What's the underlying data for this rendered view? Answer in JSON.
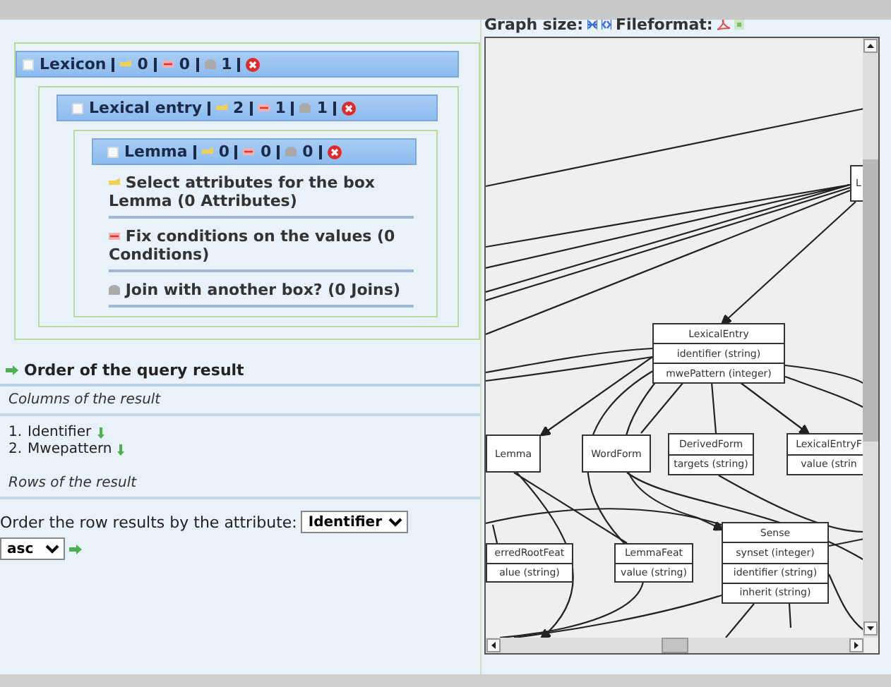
{
  "query_box": {
    "title": "Lexicon",
    "attributes": "0",
    "conditions": "0",
    "joins": "1",
    "children": [
      {
        "title": "Lexical entry",
        "attributes": "2",
        "conditions": "1",
        "joins": "1",
        "children": [
          {
            "title": "Lemma",
            "attributes": "0",
            "conditions": "0",
            "joins": "0",
            "actions": [
              {
                "kind": "attributes",
                "text": "Select attributes for the box Lemma (0 Attributes)"
              },
              {
                "kind": "conditions",
                "text": "Fix conditions on the values (0 Conditions)"
              },
              {
                "kind": "joins",
                "text": "Join with another box? (0 Joins)"
              }
            ]
          }
        ]
      }
    ]
  },
  "order": {
    "title": "Order of the query result",
    "columns_heading": "Columns of the result",
    "columns": [
      {
        "number": "1.",
        "name": "Identifier"
      },
      {
        "number": "2.",
        "name": "Mwepattern"
      }
    ],
    "rows_heading": "Rows of the result",
    "order_label": "Order the row results by the attribute:",
    "attribute": "Identifier",
    "direction": "asc"
  },
  "graph": {
    "size_label": "Graph size:",
    "format_label": "Fileformat:",
    "nodes": [
      {
        "title": "L"
      },
      {
        "title": "LexicalEntry",
        "fields": [
          "identifier (string)",
          "mwePattern (integer)"
        ]
      },
      {
        "title": "Lemma"
      },
      {
        "title": "WordForm"
      },
      {
        "title": "DerivedForm",
        "fields": [
          "targets (string)"
        ]
      },
      {
        "title": "LexicalEntryF",
        "fields": [
          "value (strin"
        ]
      },
      {
        "title": "erredRootFeat",
        "fields": [
          "alue (string)"
        ]
      },
      {
        "title": "LemmaFeat",
        "fields": [
          "value (string)"
        ]
      },
      {
        "title": "Sense",
        "fields": [
          "synset (integer)",
          "identifier (string)",
          "inherit (string)"
        ]
      }
    ]
  }
}
